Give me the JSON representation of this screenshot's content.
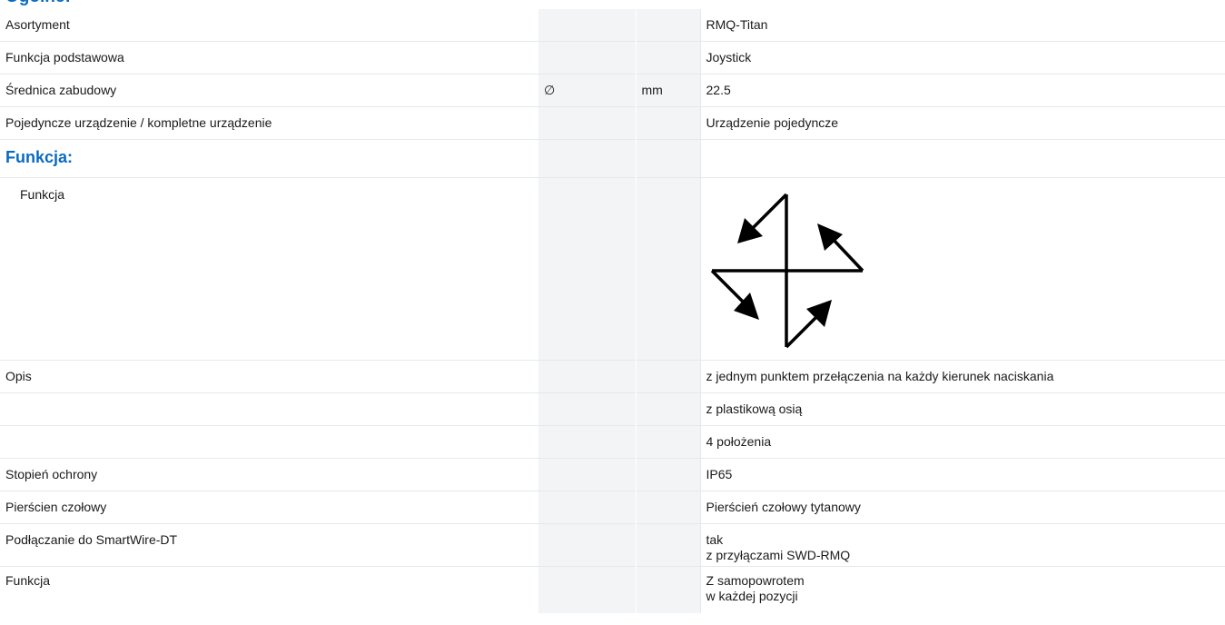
{
  "header": {
    "partial_title": "Ogólne:"
  },
  "rows": [
    {
      "label": "Asortyment",
      "symbol": "",
      "unit": "",
      "value": "RMQ-Titan"
    },
    {
      "label": "Funkcja podstawowa",
      "symbol": "",
      "unit": "",
      "value": "Joystick"
    },
    {
      "label": "Średnica zabudowy",
      "symbol": "∅",
      "unit": "mm",
      "value": "22.5"
    },
    {
      "label": "Pojedyncze urządzenie / kompletne urządzenie",
      "symbol": "",
      "unit": "",
      "value": "Urządzenie pojedyncze"
    }
  ],
  "section": {
    "title": "Funkcja:"
  },
  "function_row": {
    "label": "Funkcja",
    "diagram": "joystick-4-directions-diagram"
  },
  "rows2": [
    {
      "label": "Opis",
      "value": "z jednym punktem przełączenia na każdy kierunek naciskania"
    },
    {
      "label": "",
      "value": "z plastikową osią"
    },
    {
      "label": "",
      "value": "4 położenia"
    },
    {
      "label": "Stopień ochrony",
      "value": "IP65"
    },
    {
      "label": "Pierścien czołowy",
      "value": "Pierścień czołowy tytanowy"
    }
  ],
  "smartwire": {
    "label": "Podłączanie do SmartWire-DT",
    "value_line1": "tak",
    "value_line2": "z przyłączami SWD-RMQ"
  },
  "function_last": {
    "label": "Funkcja",
    "value_line1": "Z samopowrotem",
    "value_line2": "w każdej pozycji"
  }
}
